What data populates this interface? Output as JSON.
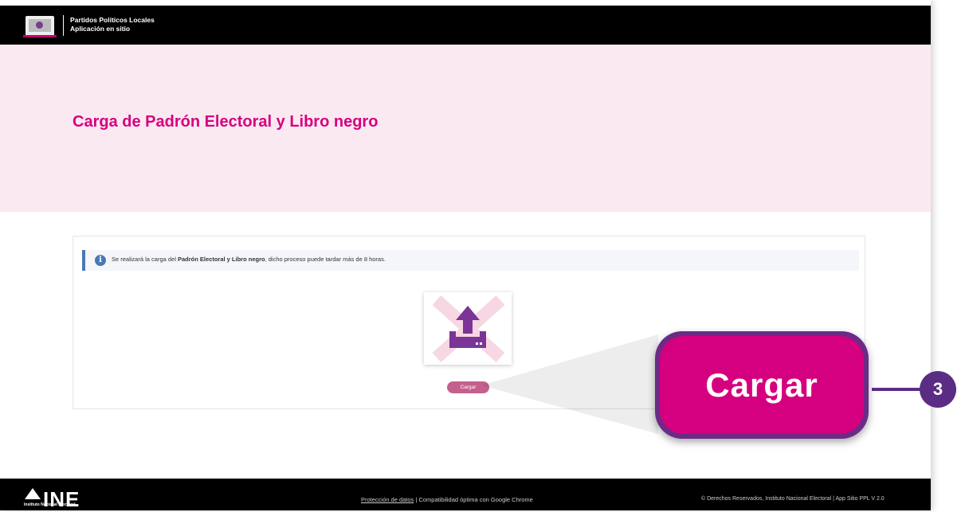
{
  "header": {
    "title": "Partidos Políticos Locales",
    "subtitle": "Aplicación en sitio"
  },
  "hero": {
    "title": "Carga de Padrón Electoral y Libro negro"
  },
  "alert": {
    "prefix": "Se realizará la carga del ",
    "bold": "Padrón Electoral y Libro negro",
    "suffix": ", dicho proceso puede tardar más de 8 horas.",
    "icon": "info-icon"
  },
  "upload": {
    "icon": "upload-icon",
    "button_label": "Cargar"
  },
  "callout": {
    "label": "Cargar",
    "step": "3"
  },
  "footer": {
    "logo": "INE",
    "logo_sub": "Instituto Nacional Electoral",
    "privacy_link": "Protección de datos",
    "compat": "Compatibilidad óptima con Google Chrome",
    "rights": "© Derechos Reservados, Instituto Nacional Electoral",
    "version": "App Sitio PPL  V 2.0"
  },
  "colors": {
    "accent": "#d5007f",
    "hero_bg": "#fbe9f1",
    "callout_border": "#6b2b86",
    "info": "#4a78b5",
    "button": "#c4608c"
  }
}
